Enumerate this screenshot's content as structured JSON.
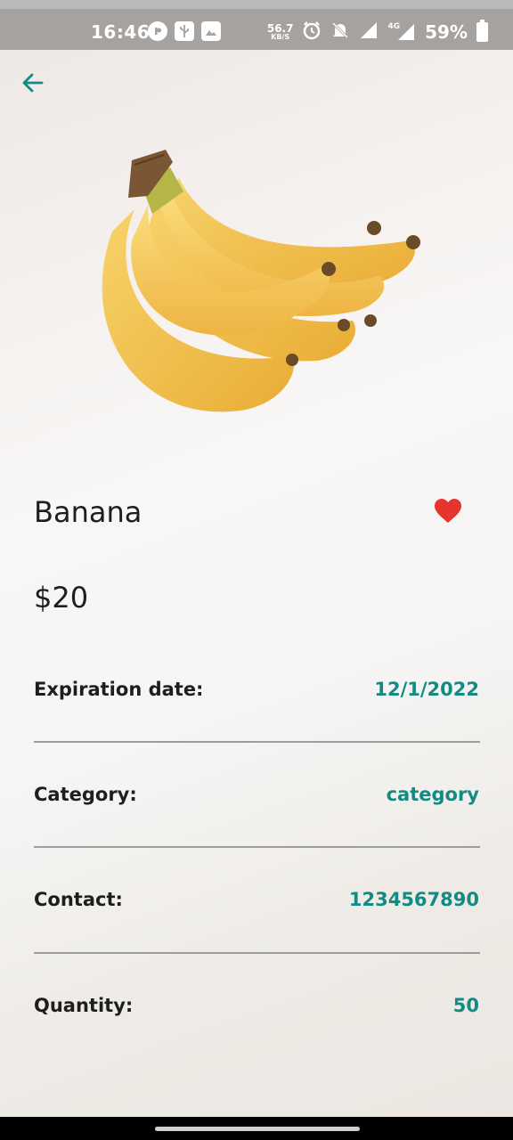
{
  "status_bar": {
    "time": "16:46",
    "speed_value": "56.7",
    "speed_unit": "KB/S",
    "network": "4G",
    "battery": "59%"
  },
  "icons": {
    "back": "arrow-left-icon",
    "favorite": "heart-icon",
    "accent_color": "#138a82",
    "favorite_color": "#e8342f"
  },
  "product": {
    "name": "Banana",
    "price": "$20",
    "details": [
      {
        "label": "Expiration date:",
        "value": "12/1/2022"
      },
      {
        "label": "Category:",
        "value": "category"
      },
      {
        "label": "Contact:",
        "value": "1234567890"
      },
      {
        "label": "Quantity:",
        "value": "50"
      }
    ]
  }
}
